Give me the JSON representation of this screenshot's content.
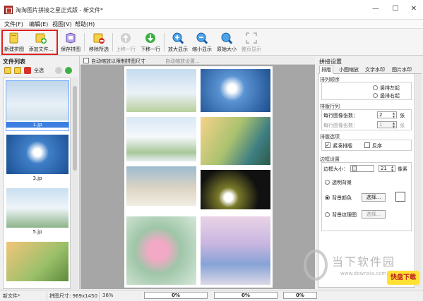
{
  "window": {
    "title": "淘淘图片拼接之星正式版 - 新文件*"
  },
  "window_controls": {
    "minimize": "—",
    "maximize": "☐",
    "close": "✕"
  },
  "menu": [
    "文件(F)",
    "编辑(E)",
    "视图(V)",
    "帮助(H)"
  ],
  "toolbar": {
    "new": "新建拼图",
    "add": "添加文件...",
    "save": "保存拼图",
    "remove": "移除所选",
    "up": "上移一行",
    "down": "下移一行",
    "zoom_in": "放大显示",
    "zoom_out": "缩小显示",
    "original": "原始大小",
    "fit": "整页显示"
  },
  "file_list": {
    "title": "文件列表",
    "select_all": "全选",
    "items": [
      {
        "name": "1.jp",
        "selected": true
      },
      {
        "name": "3.jp",
        "selected": false
      },
      {
        "name": "5.jp",
        "selected": false
      },
      {
        "name": "",
        "selected": false
      }
    ]
  },
  "canvas": {
    "auto_scale": "自动缩放以限制拼图尺寸",
    "auto_settings": "自动缩放设置..."
  },
  "settings": {
    "title": "拼接设置",
    "tabs": [
      "排版",
      "小图缩放",
      "文字水印",
      "图片水印"
    ],
    "order": {
      "title": "排列顺序",
      "left": "竖排左起",
      "right": "竖排右起",
      "left_checked": false,
      "right_checked": false
    },
    "rows": {
      "title": "排版行列",
      "per_row_label": "每行图像张数：",
      "per_row": "2",
      "unit": "张",
      "per_col_label": "每行图像张数：",
      "per_col": "1"
    },
    "options": {
      "title": "排版选项",
      "compact": "紧凑排版",
      "compact_checked": true,
      "reverse": "反序",
      "reverse_checked": false
    },
    "border": {
      "title": "边框设置",
      "size_label": "边框大小：",
      "size": "21",
      "size_unit": "像素",
      "transparent": "透明背景",
      "bg_color": "背景颜色",
      "bg_texture": "背景纹理图",
      "select": "选择...",
      "selected_option": "bg_color",
      "swatch_color": "#ffffff"
    }
  },
  "status": {
    "file": "新文件*",
    "size": "拼图尺寸: 969x1450",
    "zoom": "36%",
    "progress1": "0%",
    "progress2": "0%",
    "progress3": "0%"
  },
  "watermark": {
    "text": "当下软件园",
    "url": "www.downxia.com",
    "badge": "快盘下载"
  }
}
